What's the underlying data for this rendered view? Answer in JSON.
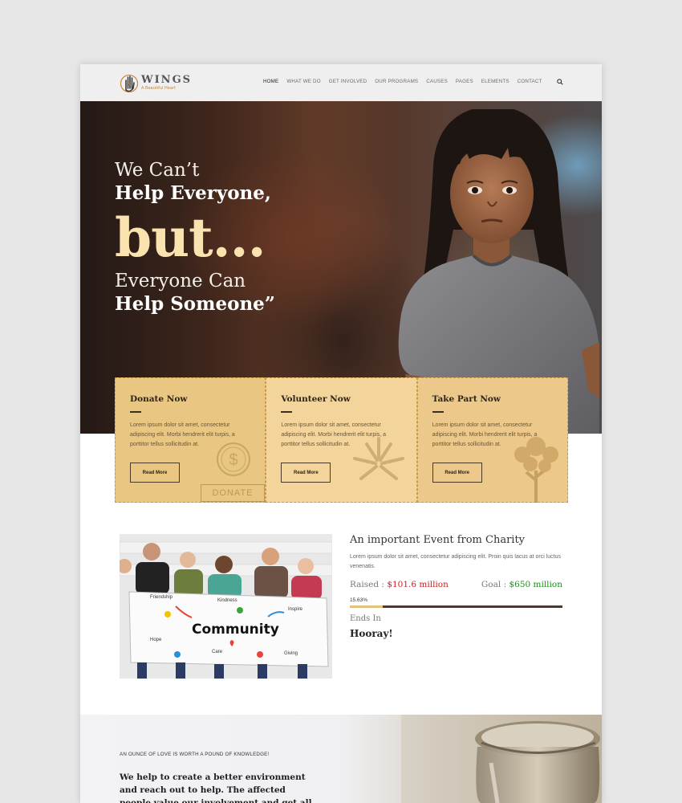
{
  "brand": {
    "name": "WINGS",
    "tagline": "A Beautiful Heart"
  },
  "nav": {
    "items": [
      "HOME",
      "WHAT WE DO",
      "GET INVOLVED",
      "OUR PROGRAMS",
      "CAUSES",
      "PAGES",
      "ELEMENTS",
      "CONTACT"
    ],
    "active": "HOME"
  },
  "hero": {
    "line1": "We Can’t",
    "line2": "Help Everyone,",
    "line3": "but...",
    "line4": "Everyone Can",
    "line5": "Help Someone”"
  },
  "cards": [
    {
      "title": "Donate Now",
      "body": "Lorem ipsum dolor sit amet, consectetur adipiscing elit. Morbi hendrerit elit turpis, a porttitor tellus sollicitudin at.",
      "button": "Read More",
      "stamp": "DONATE"
    },
    {
      "title": "Volunteer Now",
      "body": "Lorem ipsum dolor sit amet, consectetur adipiscing elit. Morbi hendrerit elit turpis, a porttitor tellus sollicitudin at.",
      "button": "Read More"
    },
    {
      "title": "Take Part Now",
      "body": "Lorem ipsum dolor sit amet, consectetur adipiscing elit. Morbi hendrerit elit turpis, a porttitor tellus sollicitudin at.",
      "button": "Read More"
    }
  ],
  "event": {
    "title": "An important Event from Charity",
    "desc": "Lorem ipsum dolor sit amet, consectetur adipiscing elit. Proin quis lacus at orci luctus venenatis.",
    "raised_label": "Raised : ",
    "raised_value": "$101.6 million",
    "goal_label": "Goal : ",
    "goal_value": "$650 million",
    "percent_label": "15.63%",
    "percent": 15.63,
    "ends_label": "Ends In",
    "ends_value": "Hooray!"
  },
  "banner": {
    "words": [
      "Friendship",
      "Kindness",
      "Inspire",
      "Community",
      "Hope",
      "Care",
      "Giving"
    ]
  },
  "bottom": {
    "kicker": "AN OUNCE OF LOVE IS WORTH A POUND OF KNOWLEDGE!",
    "text": "We help to create a better environment and reach out to help. The affected people value our involvement and get all the support at the"
  },
  "colors": {
    "accent": "#e9c783",
    "raised": "#c42121",
    "goal": "#1b8f1b",
    "hero_big": "#fbe3b0"
  }
}
